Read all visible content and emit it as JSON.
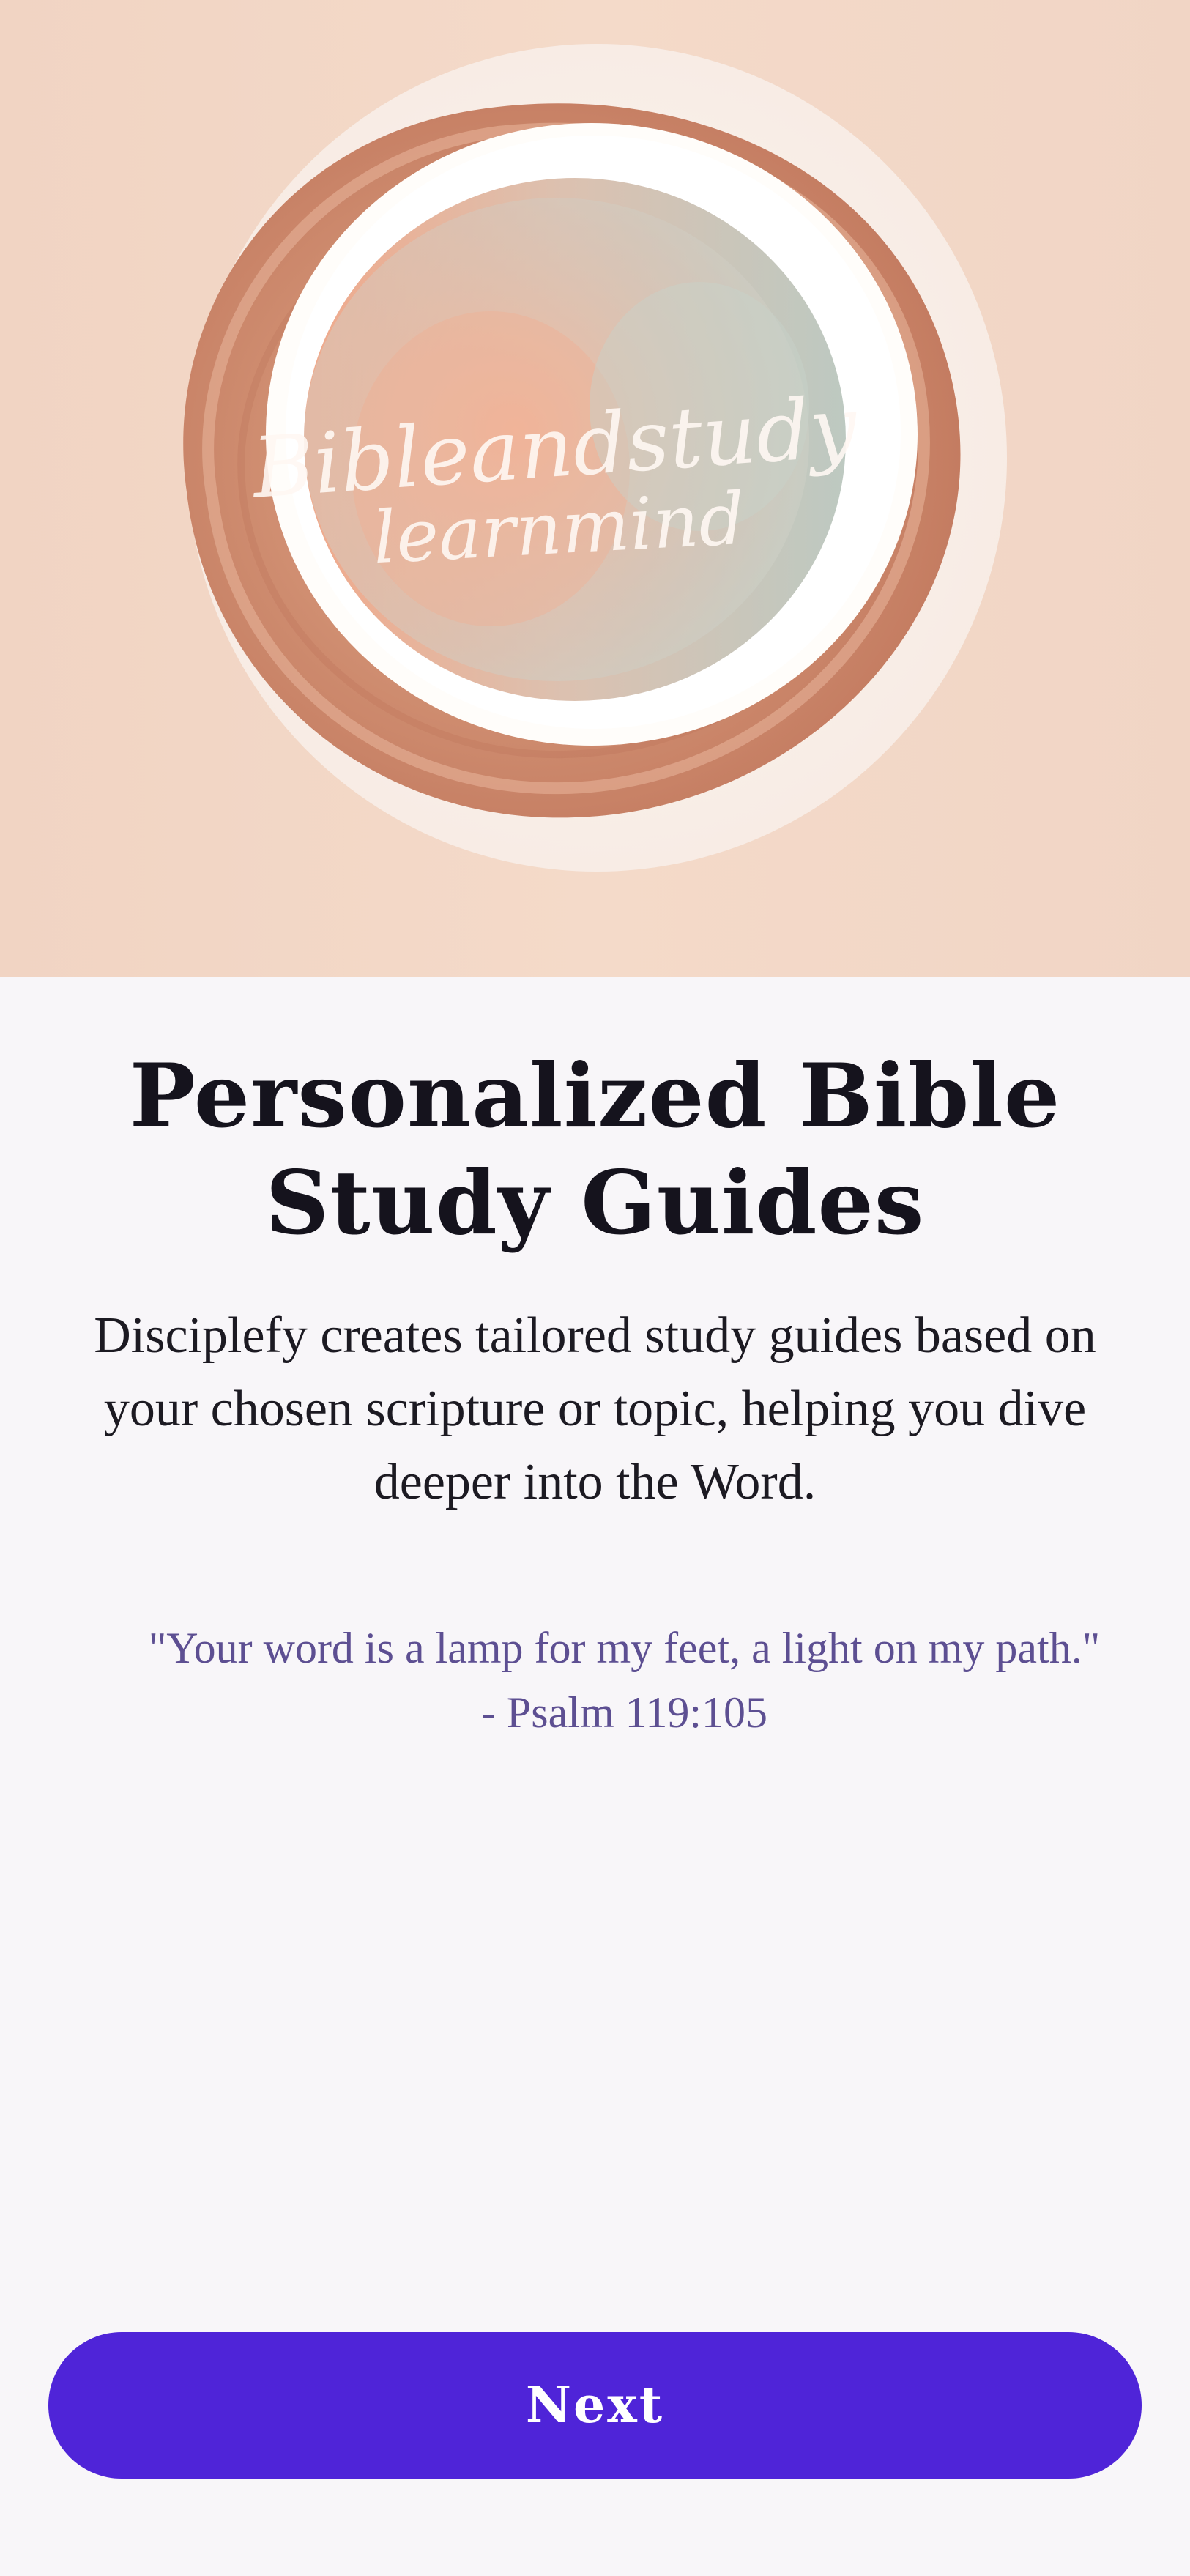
{
  "hero": {
    "logo_script_line_1": "Bibleandstudy",
    "logo_script_line_2": "learnmind",
    "colors": {
      "background": "#f2d5c5",
      "outer_ring": "#d79a7e",
      "inner_fill_warm": "#efb89f",
      "inner_fill_cool": "#cbd4cc"
    }
  },
  "onboarding": {
    "title": "Personalized Bible Study Guides",
    "description": "Disciplefy creates tailored study guides based on your chosen scripture or topic, helping you dive deeper into the Word.",
    "quote_text": "\"Your word is a lamp for my feet, a light on my path.\"",
    "quote_reference": "- Psalm 119:105",
    "next_button_label": "Next"
  },
  "colors": {
    "accent": "#4f24d8",
    "quote": "#5d4f92",
    "title": "#15131d"
  }
}
